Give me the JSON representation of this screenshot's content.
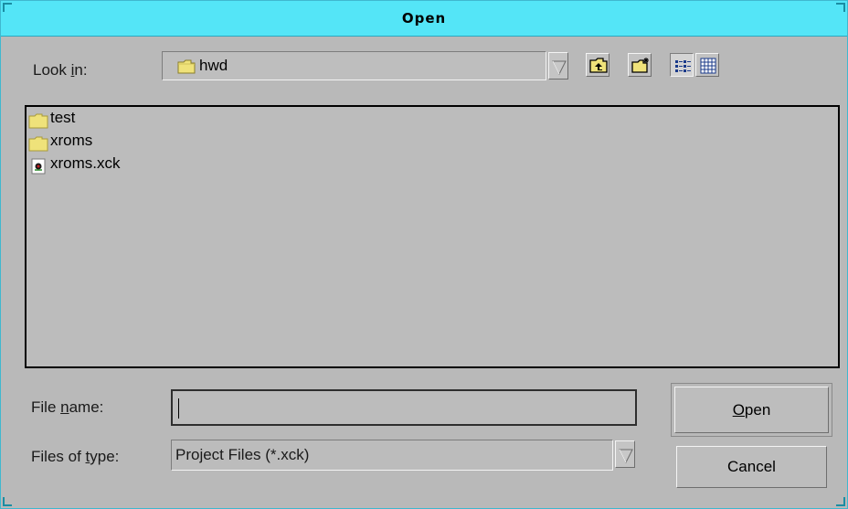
{
  "dialog": {
    "title": "Open"
  },
  "look_in": {
    "label_prefix": "Look ",
    "label_mnemonic": "i",
    "label_suffix": "n:",
    "value": "hwd"
  },
  "toolbar": {
    "icons": [
      "up-one-level-icon",
      "create-new-folder-icon",
      "list-view-icon",
      "details-view-icon"
    ]
  },
  "files": [
    {
      "name": "test",
      "icon": "folder-icon"
    },
    {
      "name": "xroms",
      "icon": "folder-icon"
    },
    {
      "name": "xroms.xck",
      "icon": "project-file-icon"
    }
  ],
  "file_name": {
    "label_prefix": "File ",
    "label_mnemonic": "n",
    "label_suffix": "ame:",
    "value": ""
  },
  "file_type": {
    "label_prefix": "Files of ",
    "label_mnemonic": "t",
    "label_suffix": "ype:",
    "value": "Project Files (*.xck)"
  },
  "buttons": {
    "open_mnemonic": "O",
    "open_rest": "pen",
    "cancel": "Cancel"
  },
  "colors": {
    "titlebar": "#54e5f7",
    "dialog_bg": "#b9b9b9",
    "folder": "#efe27a"
  }
}
